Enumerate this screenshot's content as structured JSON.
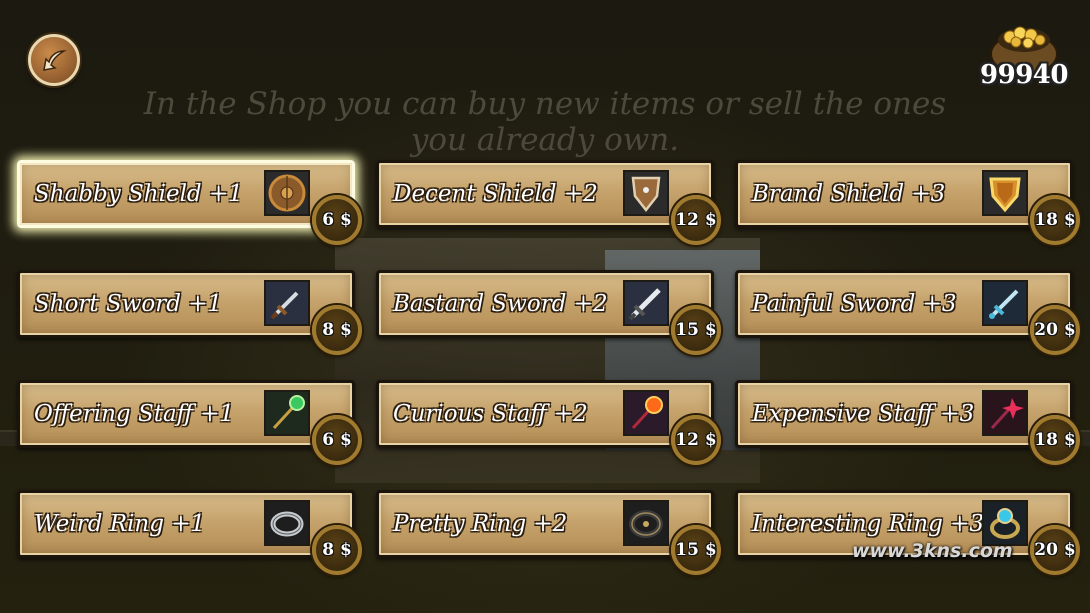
{
  "currency": {
    "amount": "99940",
    "icon": "gold-bag-icon"
  },
  "info_text": "In the Shop you can buy new items or sell the ones you already own.",
  "shop": {
    "rows": [
      {
        "items": [
          {
            "name": "Shabby Shield +1",
            "price": "6 $",
            "icon": "round-shield-icon",
            "selected": true
          },
          {
            "name": "Decent Shield +2",
            "price": "12 $",
            "icon": "kite-shield-icon",
            "selected": false
          },
          {
            "name": "Brand Shield +3",
            "price": "18 $",
            "icon": "gold-shield-icon",
            "selected": false
          }
        ]
      },
      {
        "items": [
          {
            "name": "Short Sword +1",
            "price": "8 $",
            "icon": "short-sword-icon",
            "selected": false
          },
          {
            "name": "Bastard Sword +2",
            "price": "15 $",
            "icon": "bastard-sword-icon",
            "selected": false
          },
          {
            "name": "Painful Sword +3",
            "price": "20 $",
            "icon": "blue-sword-icon",
            "selected": false
          }
        ]
      },
      {
        "items": [
          {
            "name": "Offering Staff +1",
            "price": "6 $",
            "icon": "green-staff-icon",
            "selected": false
          },
          {
            "name": "Curious Staff +2",
            "price": "12 $",
            "icon": "fire-staff-icon",
            "selected": false
          },
          {
            "name": "Expensive Staff +3",
            "price": "18 $",
            "icon": "crimson-staff-icon",
            "selected": false
          }
        ]
      },
      {
        "items": [
          {
            "name": "Weird Ring +1",
            "price": "8 $",
            "icon": "silver-ring-icon",
            "selected": false
          },
          {
            "name": "Pretty Ring +2",
            "price": "15 $",
            "icon": "dark-ring-icon",
            "selected": false
          },
          {
            "name": "Interesting Ring +3",
            "price": "20 $",
            "icon": "gem-ring-icon",
            "selected": false
          }
        ]
      }
    ]
  },
  "watermark": "www.3kns.com",
  "colors": {
    "card": "#c6a36c",
    "selected_glow": "#f0efb0",
    "coin_rim": "#a07a2e"
  }
}
